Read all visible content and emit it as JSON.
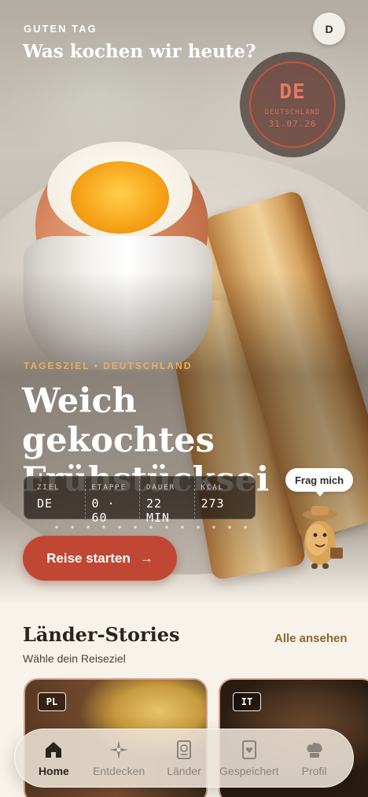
{
  "header": {
    "greeting": "GUTEN TAG",
    "headline": "Was kochen wir heute?",
    "avatar_initial": "D"
  },
  "stamp": {
    "code": "DE",
    "country": "DEUTSCHLAND",
    "date": "31.07.26"
  },
  "hero": {
    "eyebrow": "TAGESZIEL • DEUTSCHLAND",
    "title_line1": "Weich gekochtes",
    "title_line2": "Frühstücksei",
    "info": [
      {
        "label": "ZIEL",
        "value": "DE"
      },
      {
        "label": "ETAPPE",
        "value": "0 · 60"
      },
      {
        "label": "DAUER",
        "value": "22 MIN"
      },
      {
        "label": "KCAL",
        "value": "273"
      }
    ],
    "cta_label": "Reise starten",
    "cta_arrow": "→",
    "assistant_bubble": "Frag mich"
  },
  "stories": {
    "title": "Länder-Stories",
    "see_all": "Alle ansehen",
    "subtitle": "Wähle dein Reiseziel",
    "cards": [
      {
        "code": "PL"
      },
      {
        "code": "IT"
      }
    ]
  },
  "nav": {
    "items": [
      {
        "label": "Home",
        "icon": "home-icon",
        "active": true
      },
      {
        "label": "Entdecken",
        "icon": "compass-icon",
        "active": false
      },
      {
        "label": "Länder",
        "icon": "passport-icon",
        "active": false
      },
      {
        "label": "Gespeichert",
        "icon": "saved-book-icon",
        "active": false
      },
      {
        "label": "Profil",
        "icon": "chef-hat-icon",
        "active": false
      }
    ]
  },
  "colors": {
    "accent": "#c04734",
    "gold": "#e9b15a",
    "link": "#8a6a2e",
    "background": "#f7f2ea"
  }
}
